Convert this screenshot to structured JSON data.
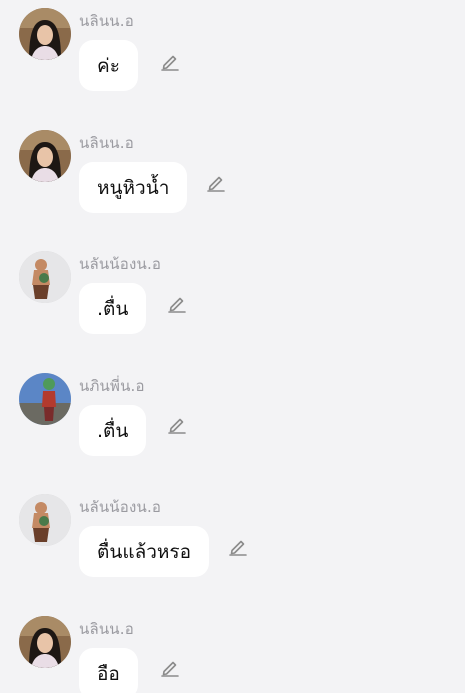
{
  "messages": [
    {
      "sender": "นลินน.อ",
      "text": "ค่ะ",
      "avatar": "avatar-woman-1"
    },
    {
      "sender": "นลินน.อ",
      "text": "หนูหิวน้ำ",
      "avatar": "avatar-woman-1"
    },
    {
      "sender": "นลันน้องน.อ",
      "text": ".ตื่น",
      "avatar": "avatar-child"
    },
    {
      "sender": "นภินพี่น.อ",
      "text": ".ตื่น",
      "avatar": "avatar-outdoor"
    },
    {
      "sender": "นลันน้องน.อ",
      "text": "ตื่นแล้วหรอ",
      "avatar": "avatar-child"
    },
    {
      "sender": "นลินน.อ",
      "text": "อือ",
      "avatar": "avatar-woman-1"
    }
  ],
  "icons": {
    "edit": "pencil-edit-icon"
  },
  "colors": {
    "background": "#f3f3f5",
    "bubble": "#ffffff",
    "sender_text": "#9a9aa0",
    "message_text": "#111111",
    "icon": "#8b8b8b"
  }
}
